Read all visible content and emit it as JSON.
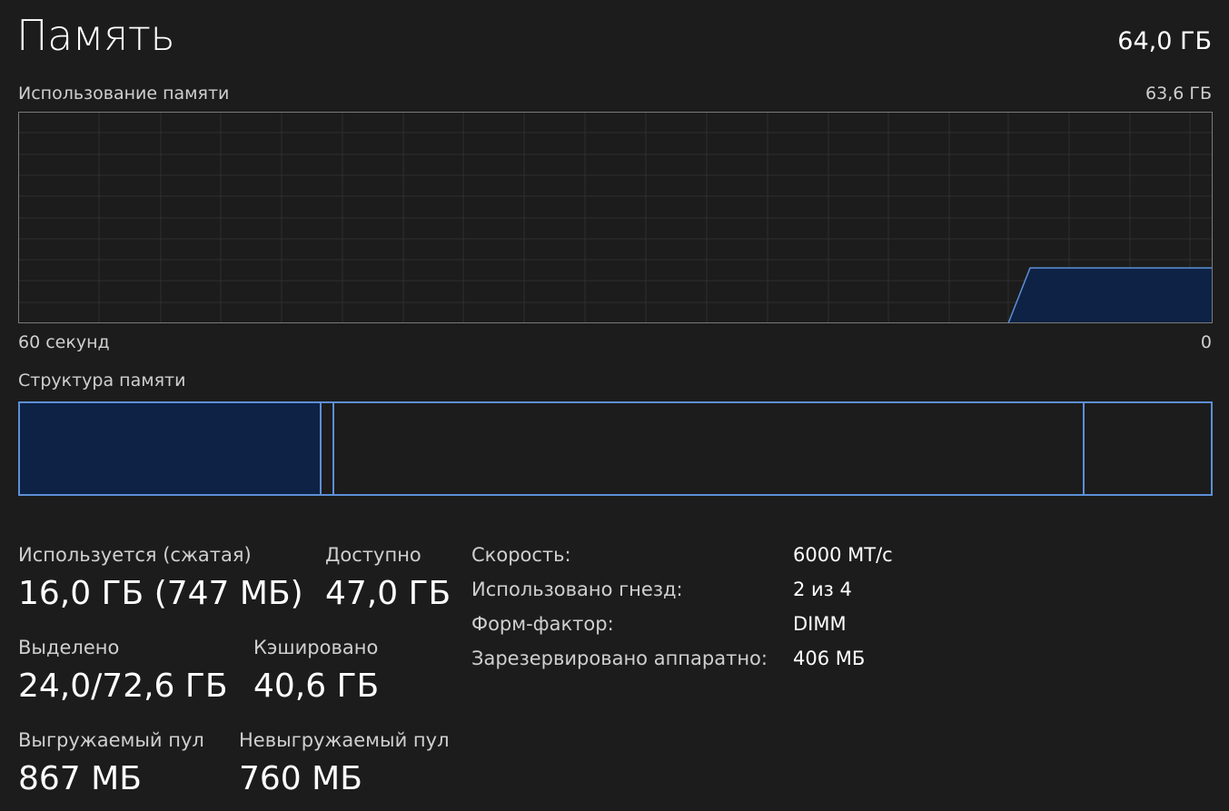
{
  "header": {
    "title": "Память",
    "capacity": "64,0 ГБ"
  },
  "usage_graph": {
    "label": "Использование памяти",
    "max_label": "63,6 ГБ",
    "time_left_label": "60 секунд",
    "time_right_label": "0",
    "line_color": "#5d8fd6",
    "fill_color": "#0e2245"
  },
  "composition": {
    "label": "Структура памяти",
    "border_color": "#5d8fd6",
    "in_use_fill": "#0e2245"
  },
  "stats": {
    "in_use": {
      "label": "Используется (сжатая)",
      "value": "16,0 ГБ (747 МБ)"
    },
    "available": {
      "label": "Доступно",
      "value": "47,0 ГБ"
    },
    "committed": {
      "label": "Выделено",
      "value": "24,0/72,6 ГБ"
    },
    "cached": {
      "label": "Кэшировано",
      "value": "40,6 ГБ"
    },
    "paged_pool": {
      "label": "Выгружаемый пул",
      "value": "867 МБ"
    },
    "non_paged_pool": {
      "label": "Невыгружаемый пул",
      "value": "760 МБ"
    }
  },
  "specs": [
    {
      "label": "Скорость:",
      "value": "6000 MT/с"
    },
    {
      "label": "Использовано гнезд:",
      "value": "2 из 4"
    },
    {
      "label": "Форм-фактор:",
      "value": "DIMM"
    },
    {
      "label": "Зарезервировано аппаратно:",
      "value": "406 МБ"
    }
  ]
}
